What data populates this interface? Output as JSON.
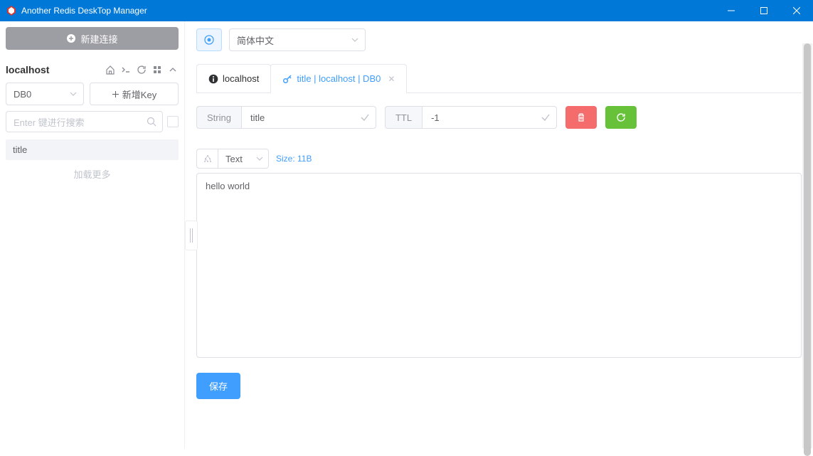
{
  "app": {
    "title": "Another Redis DeskTop Manager"
  },
  "sidebar": {
    "new_conn_label": "新建连接",
    "connection_name": "localhost",
    "db_selected": "DB0",
    "add_key_label": "新增Key",
    "search_placeholder": "Enter 键进行搜索",
    "keys": [
      {
        "name": "title"
      }
    ],
    "load_more": "加载更多"
  },
  "toolbar": {
    "lang_selected": "简体中文"
  },
  "tabs": [
    {
      "label": "localhost",
      "icon": "info"
    },
    {
      "label": "title | localhost | DB0",
      "icon": "key",
      "active": true,
      "closable": true
    }
  ],
  "key_detail": {
    "type_label": "String",
    "key_name": "title",
    "ttl_label": "TTL",
    "ttl_value": "-1",
    "format_selected": "Text",
    "size_text": "Size: 11B",
    "value": "hello world",
    "save_label": "保存"
  }
}
